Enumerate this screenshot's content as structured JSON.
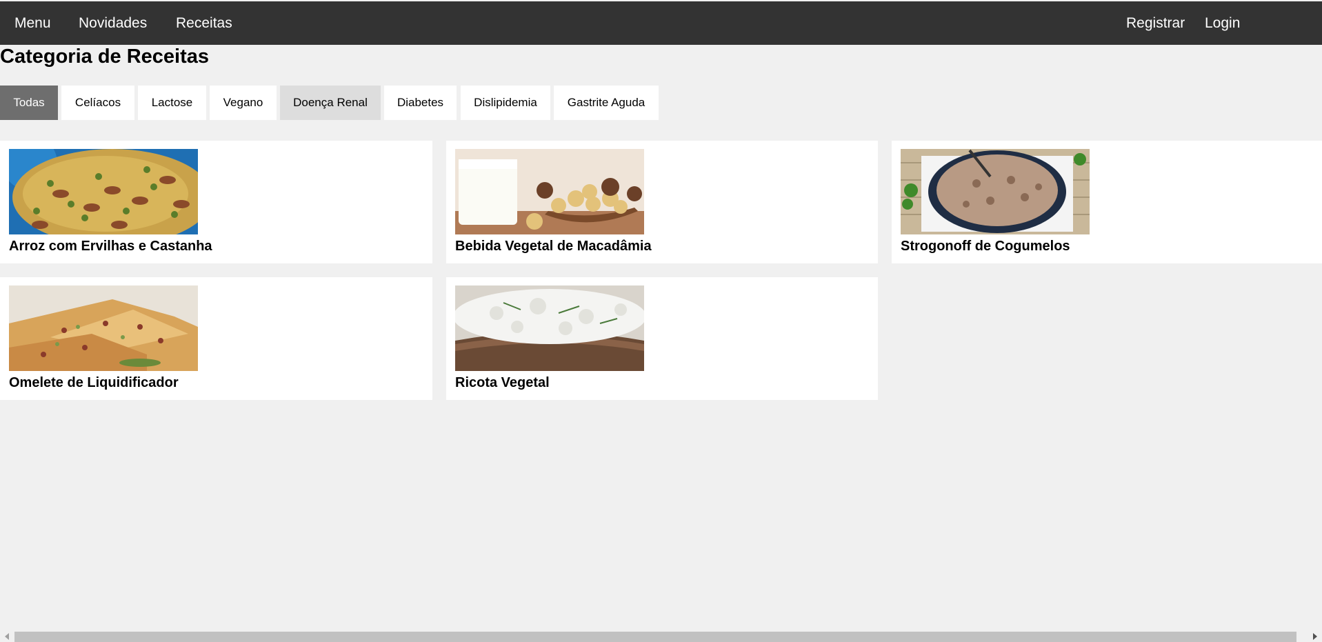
{
  "nav": {
    "menu": "Menu",
    "novidades": "Novidades",
    "receitas": "Receitas",
    "registrar": "Registrar",
    "login": "Login"
  },
  "page": {
    "title": "Categoria de Receitas"
  },
  "categories": {
    "todas": "Todas",
    "celiacos": "Celíacos",
    "lactose": "Lactose",
    "vegano": "Vegano",
    "doenca_renal": "Doença Renal",
    "diabetes": "Diabetes",
    "dislipidemia": "Dislipidemia",
    "gastrite_aguda": "Gastrite Aguda",
    "selected": "Todas"
  },
  "recipes": [
    {
      "title": "Arroz com Ervilhas e Castanha",
      "image": "rice-dish-image"
    },
    {
      "title": "Bebida Vegetal de Macadâmia",
      "image": "macadamia-milk-image"
    },
    {
      "title": "Strogonoff de Cogumelos",
      "image": "mushroom-strogonoff-image"
    },
    {
      "title": "Omelete de Liquidificador",
      "image": "omelette-image"
    },
    {
      "title": "Ricota Vegetal",
      "image": "ricotta-toast-image"
    }
  ],
  "colors": {
    "topbar": "#333333",
    "background": "#f0f0f0",
    "active_category": "#6e6e6e",
    "hover_category": "#dddddd"
  }
}
